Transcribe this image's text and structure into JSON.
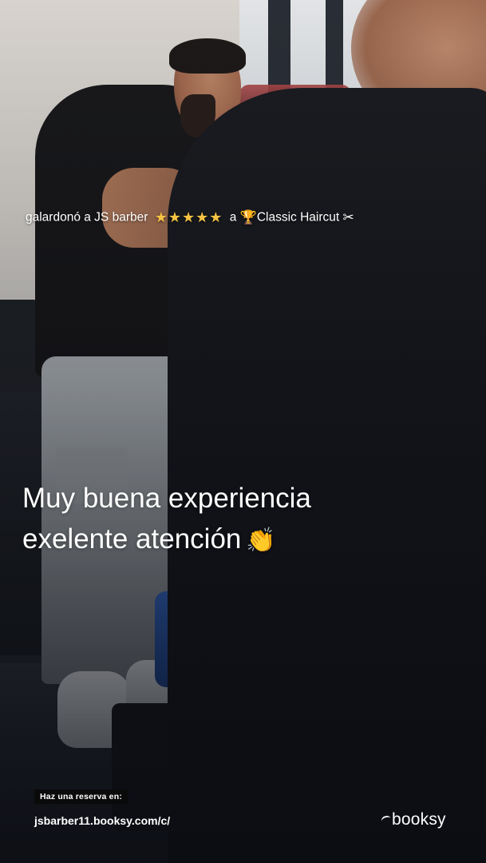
{
  "award": {
    "prefix": "galardonó a JS barber",
    "stars": "★★★★★",
    "connector": "a",
    "trophy_icon": "🏆",
    "service": "Classic Haircut",
    "tool_icon": "✂"
  },
  "review": {
    "line1": "Muy buena experiencia",
    "line2": "exelente atención",
    "clap_icon": "👏"
  },
  "cta": {
    "label": "Haz una reserva en:",
    "url": "jsbarber11.booksy.com/c/"
  },
  "brand": {
    "name": "booksy"
  },
  "colors": {
    "text": "#ffffff",
    "star": "#f6c343",
    "label_bg": "#0a0a0a"
  }
}
